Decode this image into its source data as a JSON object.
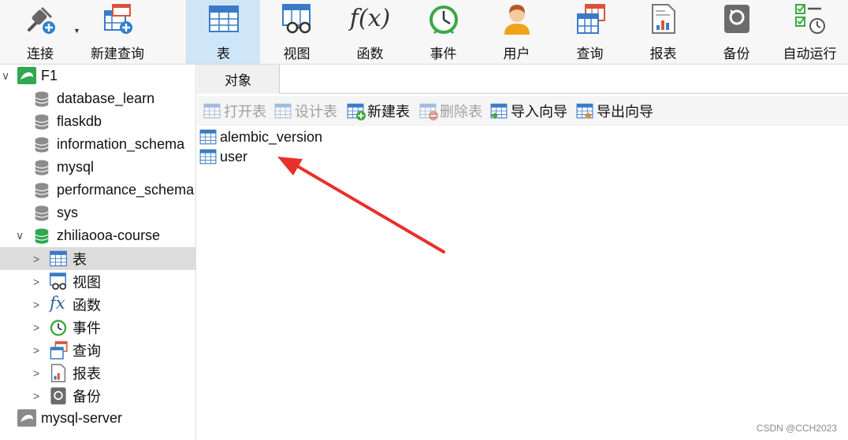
{
  "toolbar": {
    "connect": "连接",
    "new_query": "新建查询",
    "table": "表",
    "view": "视图",
    "function": "函数",
    "event": "事件",
    "user": "用户",
    "query": "查询",
    "report": "报表",
    "backup": "备份",
    "autorun": "自动运行",
    "function_glyph": "f(x)"
  },
  "colors": {
    "accent": "#3a7bc8",
    "active_bg": "#cfe6f8",
    "selected_row": "#dcdcdc",
    "arrow": "#e8302a"
  },
  "sidebar": {
    "conn1": "F1",
    "dbs": [
      "database_learn",
      "flaskdb",
      "information_schema",
      "mysql",
      "performance_schema",
      "sys"
    ],
    "open_db": "zhiliaooa-course",
    "children": [
      "表",
      "视图",
      "函数",
      "事件",
      "查询",
      "报表",
      "备份"
    ],
    "conn2": "mysql-server"
  },
  "main": {
    "tab": "对象",
    "actions": {
      "open_table": "打开表",
      "design_table": "设计表",
      "new_table": "新建表",
      "delete_table": "删除表",
      "import_wizard": "导入向导",
      "export_wizard": "导出向导"
    },
    "tables": [
      "alembic_version",
      "user"
    ]
  },
  "watermark": "CSDN @CCH2023"
}
